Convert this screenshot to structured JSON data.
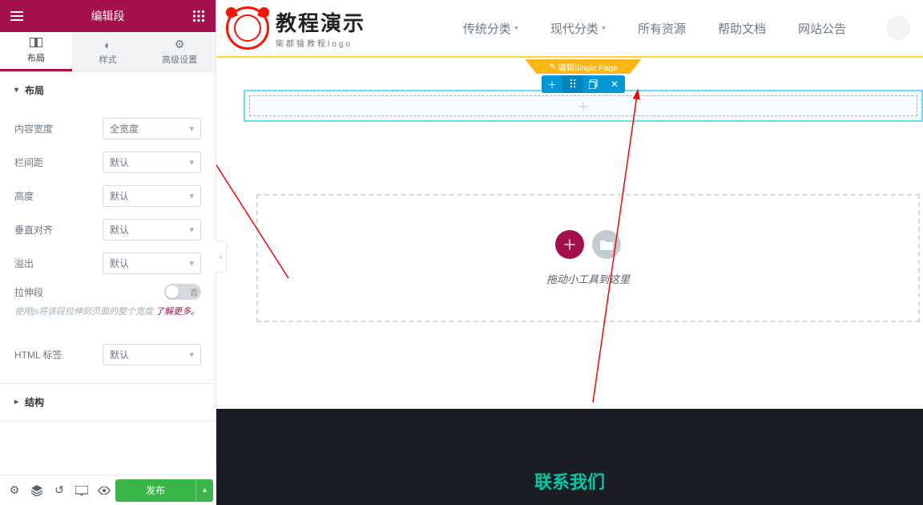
{
  "header": {
    "title": "编辑段"
  },
  "tabs": {
    "layout": "布局",
    "style": "样式",
    "advanced": "高级设置"
  },
  "sections": {
    "layout": "布局",
    "structure": "结构"
  },
  "controls": {
    "content_width": {
      "label": "内容宽度",
      "value": "全宽度"
    },
    "column_gap": {
      "label": "栏间距",
      "value": "默认"
    },
    "height": {
      "label": "高度",
      "value": "默认"
    },
    "valign": {
      "label": "垂直对齐",
      "value": "默认"
    },
    "overflow": {
      "label": "溢出",
      "value": "默认"
    },
    "stretch": {
      "label": "拉伸段",
      "switch_off": "否"
    },
    "stretch_desc": "使用js将该段拉伸到页面的整个宽度",
    "stretch_link": "了解更多。",
    "html_tag": {
      "label": "HTML 标签",
      "value": "默认"
    }
  },
  "bottom": {
    "publish": "发布"
  },
  "site": {
    "logo_title": "教程演示",
    "logo_sub": "柴郡猫教程logo",
    "nav": {
      "trad": "传统分类",
      "modern": "现代分类",
      "all": "所有资源",
      "help": "帮助文档",
      "notice": "网站公告"
    }
  },
  "canvas": {
    "page_badge": "编辑Single Page",
    "drop_text": "拖动小工具到这里",
    "plus": "＋"
  },
  "footer": {
    "contact": "联系我们"
  }
}
